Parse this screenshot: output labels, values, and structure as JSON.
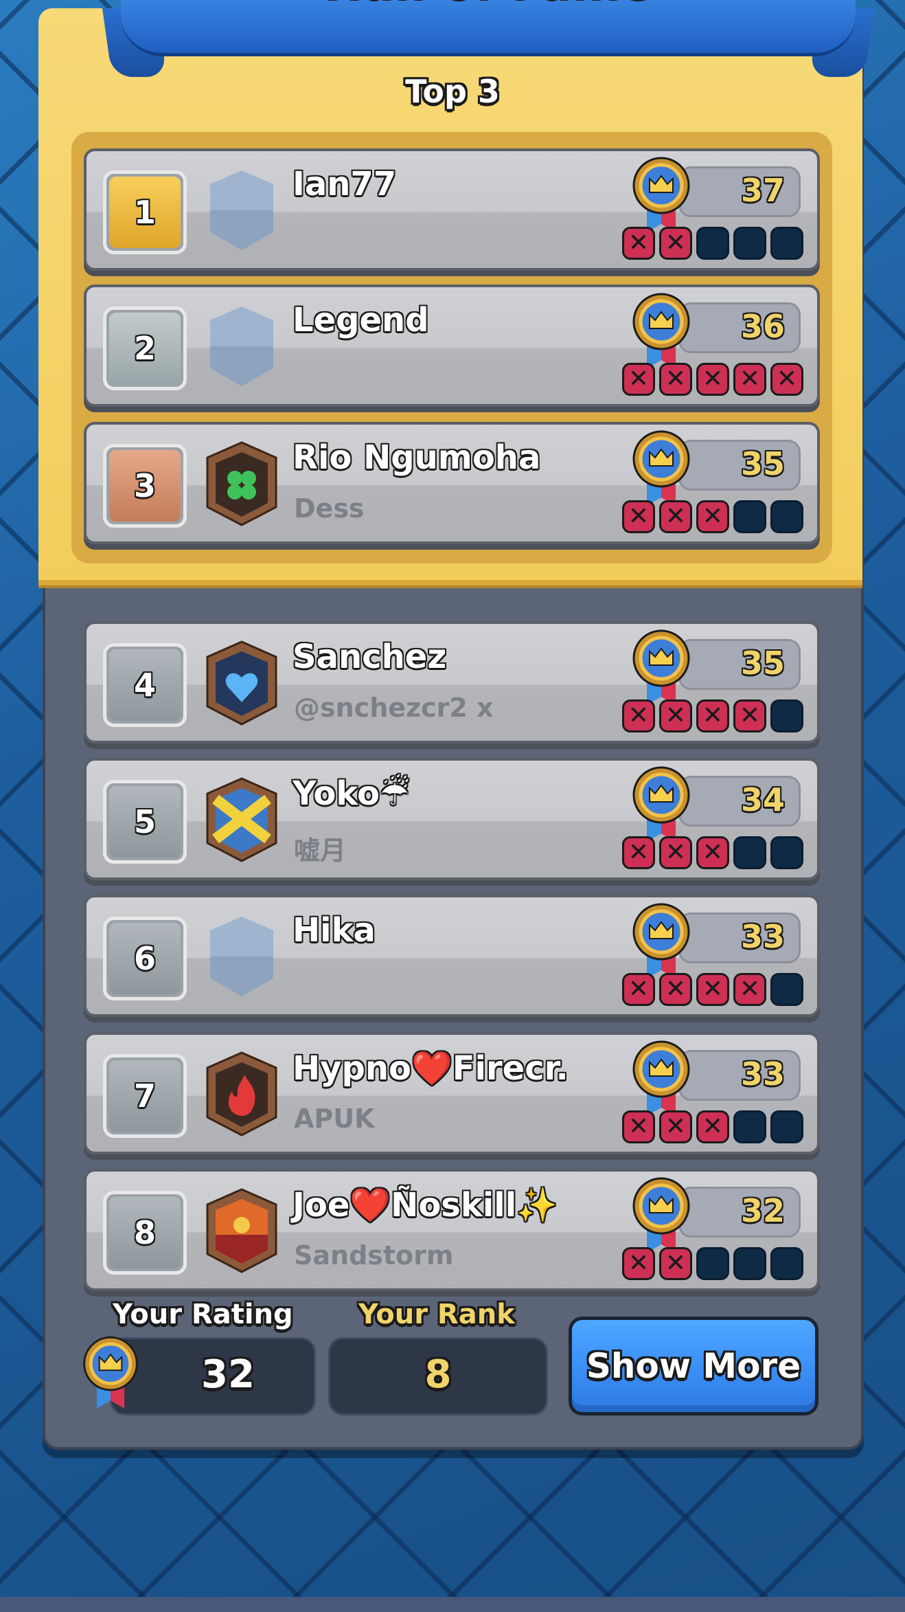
{
  "header": {
    "title": "Hall of Fame",
    "subtitle": "Top 3"
  },
  "colors": {
    "accent_blue": "#3a8ff6",
    "gold": "#f2cd5c",
    "loss_red": "#ce2f55",
    "score_yellow": "#f0d46a"
  },
  "players": [
    {
      "rank": "1",
      "name": "Ian77",
      "clan": "",
      "rating": "37",
      "wins": 2,
      "badge": "empty-shield",
      "rank_style": "gold"
    },
    {
      "rank": "2",
      "name": "Legend",
      "clan": "",
      "rating": "36",
      "wins": 5,
      "badge": "empty-shield",
      "rank_style": "silver"
    },
    {
      "rank": "3",
      "name": "Rio Ngumoha",
      "clan": "Dess",
      "rating": "35",
      "wins": 3,
      "badge": "clover-badge",
      "rank_style": "bronze"
    },
    {
      "rank": "4",
      "name": "Sanchez",
      "clan": "@snchezcr2 x",
      "rating": "35",
      "wins": 4,
      "badge": "heart-badge",
      "rank_style": "grey"
    },
    {
      "rank": "5",
      "name": "Yoko☔",
      "clan": "嘘月",
      "rating": "34",
      "wins": 3,
      "badge": "cross-badge",
      "rank_style": "grey"
    },
    {
      "rank": "6",
      "name": "Hika",
      "clan": "",
      "rating": "33",
      "wins": 4,
      "badge": "empty-shield",
      "rank_style": "grey"
    },
    {
      "rank": "7",
      "name": "Hypno❤️Firecr.",
      "clan": "APUK",
      "rating": "33",
      "wins": 3,
      "badge": "flame-badge",
      "rank_style": "grey"
    },
    {
      "rank": "8",
      "name": "Joe❤️Ñoskill✨",
      "clan": "Sandstorm",
      "rating": "32",
      "wins": 2,
      "badge": "sun-badge",
      "rank_style": "grey"
    }
  ],
  "slots_total": 5,
  "footer": {
    "rating_label": "Your Rating",
    "rating_value": "32",
    "rank_label": "Your Rank",
    "rank_value": "8",
    "show_more_label": "Show More"
  }
}
